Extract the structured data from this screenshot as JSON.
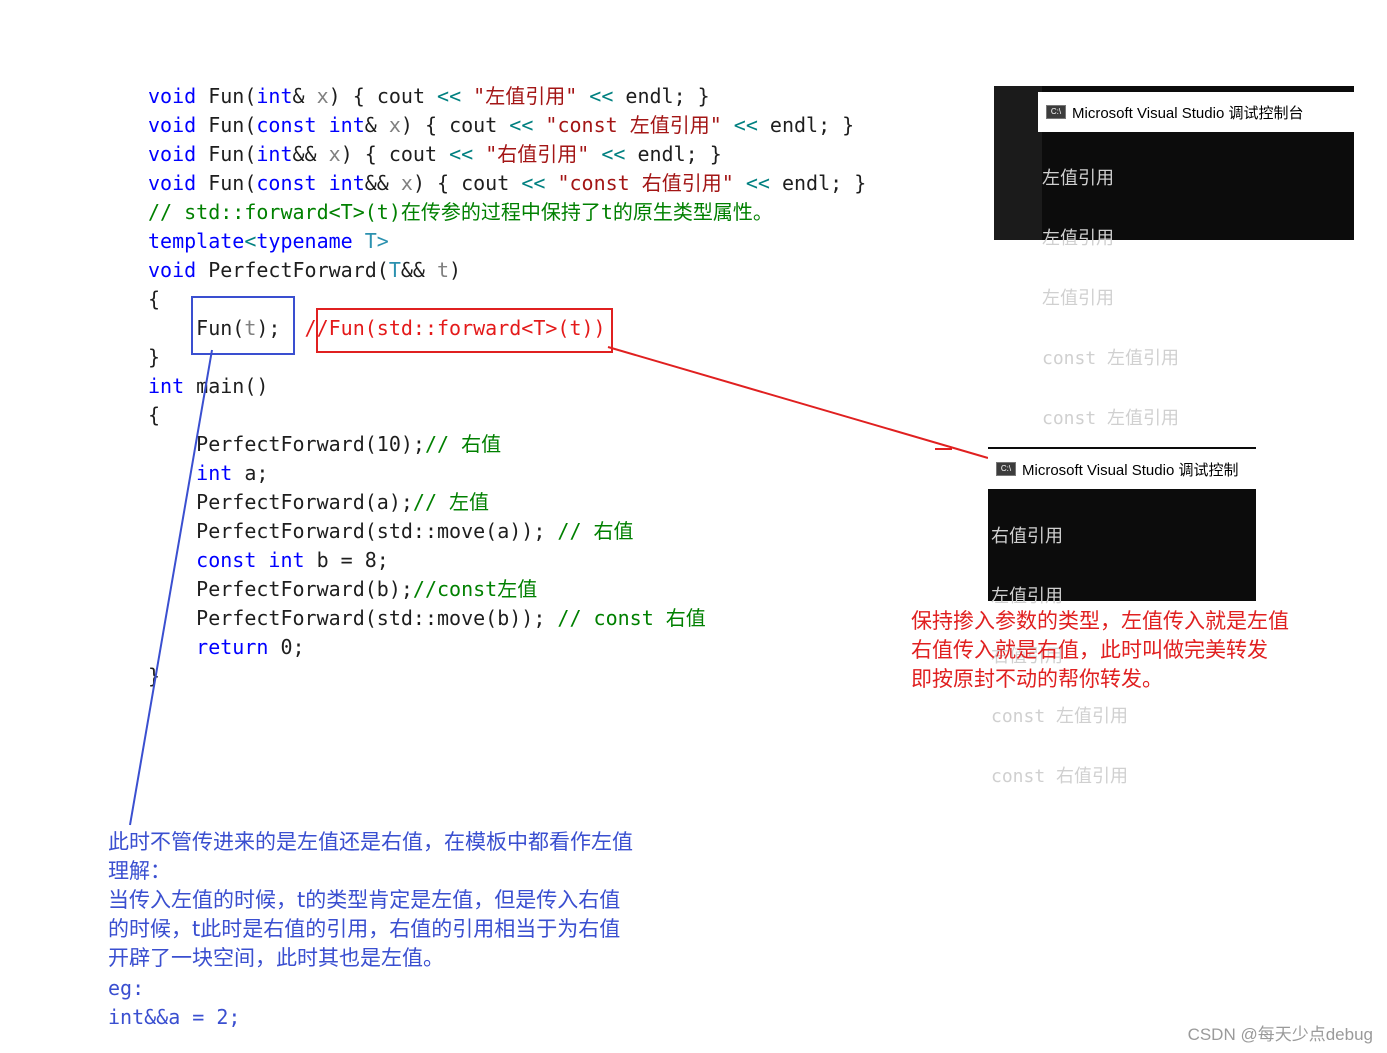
{
  "code": {
    "l1": {
      "a": "void",
      "b": " Fun(",
      "c": "int",
      "d": "& ",
      "e": "x",
      ") ": "",
      "f": ") { cout ",
      "g": "<<",
      "h": " \"左值引用\" ",
      "i": "<<",
      "j": " endl; }"
    },
    "l2": {
      "a": "void",
      "b": " Fun(",
      "c": "const int",
      "d": "& ",
      "e": "x",
      "f": ") { cout ",
      "g": "<<",
      "h": " \"const 左值引用\" ",
      "i": "<<",
      "j": " endl; }"
    },
    "l3": {
      "a": "void",
      "b": " Fun(",
      "c": "int",
      "d": "&& ",
      "e": "x",
      "f": ") { cout ",
      "g": "<<",
      "h": " \"右值引用\" ",
      "i": "<<",
      "j": " endl; }"
    },
    "l4": {
      "a": "void",
      "b": " Fun(",
      "c": "const int",
      "d": "&& ",
      "e": "x",
      "f": ") { cout ",
      "g": "<<",
      "h": " \"const 右值引用\" ",
      "i": "<<",
      "j": " endl; }"
    },
    "l5": "// std::forward<T>(t)在传参的过程中保持了t的原生类型属性。",
    "l6": {
      "a": "template",
      "b": "<",
      "c": "typename",
      "d": " T>"
    },
    "l7": {
      "a": "void",
      "b": " PerfectForward(",
      "c": "T",
      "d": "&& ",
      "e": "t",
      ") ": "",
      "f": ")"
    },
    "l8": "{",
    "l9": {
      "a": "    Fun(",
      "b": "t",
      "c": ");  ",
      "d": "//Fun(std::forward<T>(t))"
    },
    "l10": "}",
    "l11": {
      "a": "int",
      "b": " main()"
    },
    "l12": "{",
    "l13": {
      "a": "    PerfectForward(10);",
      "b": "// 右值"
    },
    "l14": {
      "a": "    ",
      "b": "int",
      "c": " a;"
    },
    "l15": {
      "a": "    PerfectForward(a);",
      "b": "// 左值"
    },
    "l16": {
      "a": "    PerfectForward(std::move(a)); ",
      "b": "// 右值"
    },
    "l17": {
      "a": "    ",
      "b": "const int",
      "c": " b = 8;"
    },
    "l18": {
      "a": "    PerfectForward(b);",
      "b": "//const左值"
    },
    "l19": {
      "a": "    PerfectForward(std::move(b)); ",
      "b": "// const 右值"
    },
    "l20": {
      "a": "    ",
      "b": "return",
      "c": " 0;"
    },
    "l21": "}"
  },
  "console1": {
    "title": "Microsoft Visual Studio 调试控制台",
    "icon": "C:\\",
    "lines": [
      "左值引用",
      "左值引用",
      "左值引用",
      "const 左值引用",
      "const 左值引用"
    ]
  },
  "console2": {
    "title": "Microsoft Visual Studio 调试控制",
    "icon": "C:\\",
    "lines": [
      "右值引用",
      "左值引用",
      "右值引用",
      "const 左值引用",
      "const 右值引用"
    ]
  },
  "annotation_red": "保持掺入参数的类型，左值传入就是左值\n右值传入就是右值，此时叫做完美转发\n即按原封不动的帮你转发。",
  "annotation_blue": "此时不管传进来的是左值还是右值，在模板中都看作左值\n理解：\n当传入左值的时候，t的类型肯定是左值，但是传入右值\n的时候，t此时是右值的引用，右值的引用相当于为右值\n开辟了一块空间，此时其也是左值。",
  "annotation_blue_code": "eg:\nint&&a = 2;",
  "watermark": "CSDN @每天少点debug",
  "colors": {
    "keyword": "#0000ff",
    "type": "#2b91af",
    "string": "#a31515",
    "comment": "#008000",
    "annotation_red": "#e02020",
    "annotation_blue": "#3a4fd0"
  }
}
